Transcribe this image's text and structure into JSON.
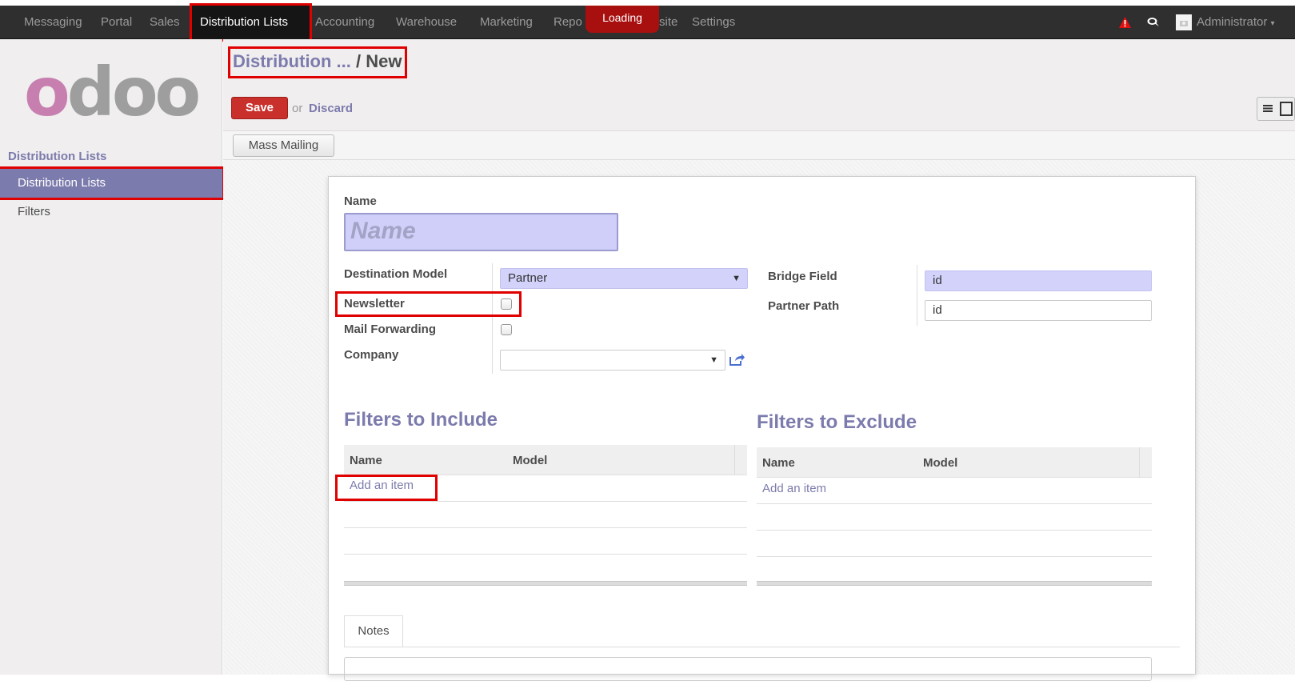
{
  "topbar": {
    "menu": [
      "Messaging",
      "Portal",
      "Sales",
      "Distribution Lists",
      "Accounting",
      "Warehouse",
      "Marketing",
      "Repo",
      "site",
      "Settings"
    ],
    "loading": "Loading",
    "user": "Administrator"
  },
  "sidebar": {
    "section_title": "Distribution Lists",
    "items": [
      "Distribution Lists",
      "Filters"
    ]
  },
  "header": {
    "breadcrumb_parent": "Distribution ...",
    "breadcrumb_sep": "/",
    "breadcrumb_current": "New",
    "save_label": "Save",
    "or_label": "or",
    "discard_label": "Discard",
    "mass_mailing_label": "Mass Mailing"
  },
  "form": {
    "name_label": "Name",
    "name_placeholder": "Name",
    "destination_model_label": "Destination Model",
    "destination_model_value": "Partner",
    "newsletter_label": "Newsletter",
    "mail_forwarding_label": "Mail Forwarding",
    "company_label": "Company",
    "company_value": "",
    "bridge_field_label": "Bridge Field",
    "bridge_field_value": "id",
    "partner_path_label": "Partner Path",
    "partner_path_value": "id"
  },
  "filters_include": {
    "title": "Filters to Include",
    "columns": [
      "Name",
      "Model"
    ],
    "add_item": "Add an item"
  },
  "filters_exclude": {
    "title": "Filters to Exclude",
    "columns": [
      "Name",
      "Model"
    ],
    "add_item": "Add an item"
  },
  "tabs": {
    "notes": "Notes"
  }
}
